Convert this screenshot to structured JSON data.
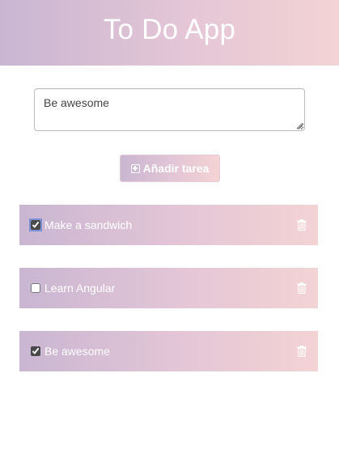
{
  "app": {
    "title": "To Do App"
  },
  "input": {
    "value": "Be awesome",
    "placeholder": ""
  },
  "add_button": {
    "label": "Añadir tarea",
    "icon": "plus-square-icon"
  },
  "tasks": [
    {
      "label": "Make a sandwich",
      "done": true,
      "icon": "trash-icon"
    },
    {
      "label": "Learn Angular",
      "done": false,
      "icon": "trash-icon"
    },
    {
      "label": "Be awesome",
      "done": true,
      "icon": "trash-icon"
    }
  ],
  "colors": {
    "gradient_start": "#c9b6d2",
    "gradient_mid": "#e4c6d6",
    "gradient_end": "#f3d3d4",
    "text_on_gradient": "#ffffff"
  }
}
